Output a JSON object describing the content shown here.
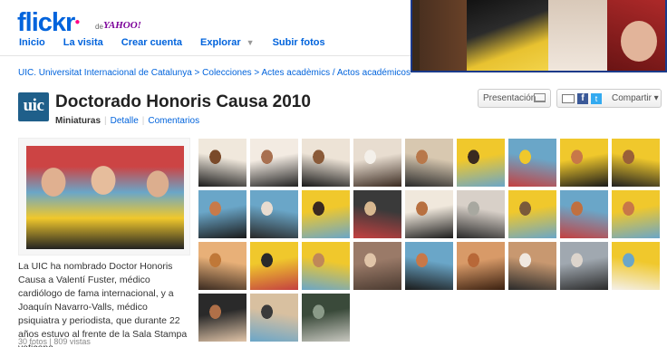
{
  "header": {
    "logo_main": "flickr",
    "logo_dot": "●",
    "logo_de": "de",
    "logo_yahoo": "YAHOO!",
    "nav": [
      {
        "label": "Inicio"
      },
      {
        "label": "La visita"
      },
      {
        "label": "Crear cuenta"
      },
      {
        "label": "Explorar"
      },
      {
        "label": "Subir fotos"
      }
    ]
  },
  "breadcrumb": "UIC. Universitat Internacional de Catalunya > Colecciones > Actes acadèmics / Actos académicos",
  "set": {
    "owner_logo_text": "uic",
    "title": "Doctorado Honoris Causa 2010",
    "view_current": "Miniaturas",
    "view_detail": "Detalle",
    "view_comments": "Comentarios",
    "description": "La UIC ha nombrado Doctor Honoris Causa a Valentí Fuster, médico cardiólogo de fama internacional, y a Joaquín Navarro-Valls, médico psiquiatra y periodista, que durante 22 años estuvo al frente de la Sala Stampa vaticana.",
    "stats": "30 fotos | 809 vistas"
  },
  "actions": {
    "slideshow_label": "Presentación",
    "share_label": "Compartir ▾",
    "fb_letter": "f",
    "tw_letter": "t"
  },
  "thumbnails": [
    {
      "colors": [
        "#7a4a2a",
        "#f0e8dc",
        "#1c1c1c"
      ]
    },
    {
      "colors": [
        "#a87050",
        "#f3ebe2",
        "#222222"
      ]
    },
    {
      "colors": [
        "#8a5a38",
        "#ede3d6",
        "#181818"
      ]
    },
    {
      "colors": [
        "#f4f0ea",
        "#e8ddd0",
        "#3a2a20"
      ]
    },
    {
      "colors": [
        "#b8784a",
        "#d8c8b0",
        "#2a2a2a"
      ]
    },
    {
      "colors": [
        "#3a2a20",
        "#f0c82c",
        "#6aa6c8"
      ]
    },
    {
      "colors": [
        "#f0c82c",
        "#6aa6c8",
        "#c44040"
      ]
    },
    {
      "colors": [
        "#c87848",
        "#f0c82c",
        "#1a1a1a"
      ]
    },
    {
      "colors": [
        "#9a6038",
        "#f0c82c",
        "#202020"
      ]
    },
    {
      "colors": [
        "#c87a4a",
        "#6aa6c8",
        "#1a1a1a"
      ]
    },
    {
      "colors": [
        "#e8dcd0",
        "#6aa6c8",
        "#282828"
      ]
    },
    {
      "colors": [
        "#3a2a20",
        "#f0c82c",
        "#6aa6c8"
      ]
    },
    {
      "colors": [
        "#d8b890",
        "#3a3a3a",
        "#c44040"
      ]
    },
    {
      "colors": [
        "#b87040",
        "#f0e8dc",
        "#1c1c1c"
      ]
    },
    {
      "colors": [
        "#a8a8a0",
        "#d8d0c8",
        "#2a2a2a"
      ]
    },
    {
      "colors": [
        "#7a5a3a",
        "#f0c82c",
        "#6aa6c8"
      ]
    },
    {
      "colors": [
        "#c07040",
        "#6aa6c8",
        "#c44040"
      ]
    },
    {
      "colors": [
        "#c87848",
        "#f0c82c",
        "#6aa6c8"
      ]
    },
    {
      "colors": [
        "#c07838",
        "#e8b078",
        "#3a2a20"
      ]
    },
    {
      "colors": [
        "#2a2a2a",
        "#f0c82c",
        "#c44040"
      ]
    },
    {
      "colors": [
        "#c08858",
        "#f0c82c",
        "#6aa6c8"
      ]
    },
    {
      "colors": [
        "#e0c4a8",
        "#9a7a68",
        "#4a3a30"
      ]
    },
    {
      "colors": [
        "#c87848",
        "#6aa6c8",
        "#1a1a1a"
      ]
    },
    {
      "colors": [
        "#b86838",
        "#d89a68",
        "#3a2010"
      ]
    },
    {
      "colors": [
        "#f0e8e0",
        "#c89870",
        "#2a2a2a"
      ]
    },
    {
      "colors": [
        "#dcd4cc",
        "#a0a8b0",
        "#2a2a2a"
      ]
    },
    {
      "colors": [
        "#6aa6c8",
        "#f0c82c",
        "#f4f0ea"
      ]
    },
    {
      "colors": [
        "#b07048",
        "#2a2a2a",
        "#e0c4a8"
      ]
    },
    {
      "colors": [
        "#3a3a3a",
        "#d8c0a0",
        "#6aa6c8"
      ]
    },
    {
      "colors": [
        "#8a9a88",
        "#3a4a3a",
        "#c8c8c0"
      ]
    }
  ]
}
